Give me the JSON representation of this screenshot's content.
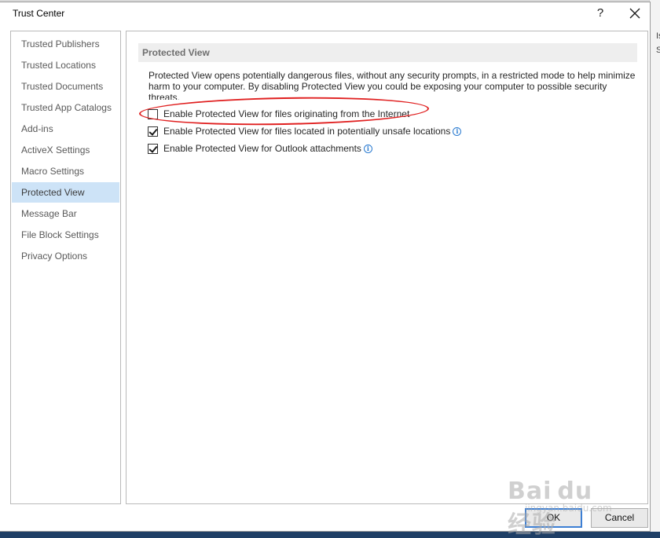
{
  "dialog": {
    "title": "Trust Center",
    "help_label": "?",
    "close_label": "close"
  },
  "sidebar": {
    "items": [
      {
        "label": "Trusted Publishers"
      },
      {
        "label": "Trusted Locations"
      },
      {
        "label": "Trusted Documents"
      },
      {
        "label": "Trusted App Catalogs"
      },
      {
        "label": "Add-ins"
      },
      {
        "label": "ActiveX Settings"
      },
      {
        "label": "Macro Settings"
      },
      {
        "label": "Protected View",
        "selected": true
      },
      {
        "label": "Message Bar"
      },
      {
        "label": "File Block Settings"
      },
      {
        "label": "Privacy Options"
      }
    ]
  },
  "main": {
    "section_title": "Protected View",
    "description": "Protected View opens potentially dangerous files, without any security prompts, in a restricted mode to help minimize harm to your computer. By disabling Protected View you could be exposing your computer to possible security threats.",
    "options": [
      {
        "label": "Enable Protected View for files originating from the Internet",
        "checked": false,
        "info_icon": false
      },
      {
        "label": "Enable Protected View for files located in potentially unsafe locations",
        "checked": true,
        "info_icon": true
      },
      {
        "label": "Enable Protected View for Outlook attachments",
        "checked": true,
        "info_icon": true
      }
    ],
    "info_icon_glyph": "i"
  },
  "footer": {
    "ok_label": "OK",
    "cancel_label": "Cancel"
  },
  "background": {
    "right_text": [
      "Is",
      "S"
    ]
  },
  "watermark": {
    "brand": "Bai du 经验",
    "sub": "jingyan.baidu.com"
  },
  "colors": {
    "selected_bg": "#cde3f7",
    "section_header_bg": "#eeeeee",
    "annotation_circle": "#e02020",
    "default_button_border": "#3c7fd4",
    "info_icon": "#2b7bd0"
  }
}
